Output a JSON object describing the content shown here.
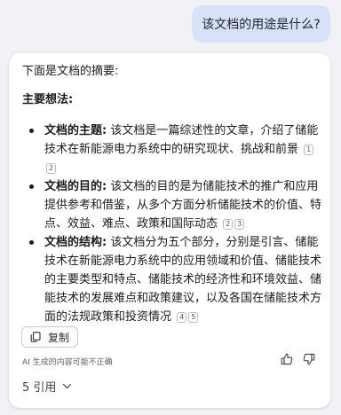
{
  "user_message": "该文档的用途是什么?",
  "answer": {
    "intro": "下面是文档的摘要:",
    "heading": "主要想法:",
    "bullets": [
      {
        "label": "文档的主题:",
        "text": " 该文档是一篇综述性的文章，介绍了储能技术在新能源电力系统中的研究现状、挑战和前景",
        "citations": [
          "1",
          "2"
        ]
      },
      {
        "label": "文档的目的:",
        "text": " 该文档的目的是为储能技术的推广和应用提供参考和借鉴，从多个方面分析储能技术的价值、特点、效益、难点、政策和国际动态",
        "citations": [
          "2",
          "3"
        ]
      },
      {
        "label": "文档的结构:",
        "text": " 该文档分为五个部分，分别是引言、储能技术在新能源电力系统中的应用领域和价值、储能技术的主要类型和特点、储能技术的经济性和环境效益、储能技术的发展难点和政策建议，以及各国在储能技术方面的法规政策和投资情况",
        "citations": [
          "4",
          "5"
        ]
      }
    ],
    "copy_label": "复制",
    "disclaimer": "AI 生成的内容可能不正确",
    "references_label": "5 引用"
  },
  "icons": {
    "copy": "copy-icon",
    "thumb_up": "thumb-up-icon",
    "thumb_down": "thumb-down-icon",
    "chevron": "chevron-down-icon"
  }
}
